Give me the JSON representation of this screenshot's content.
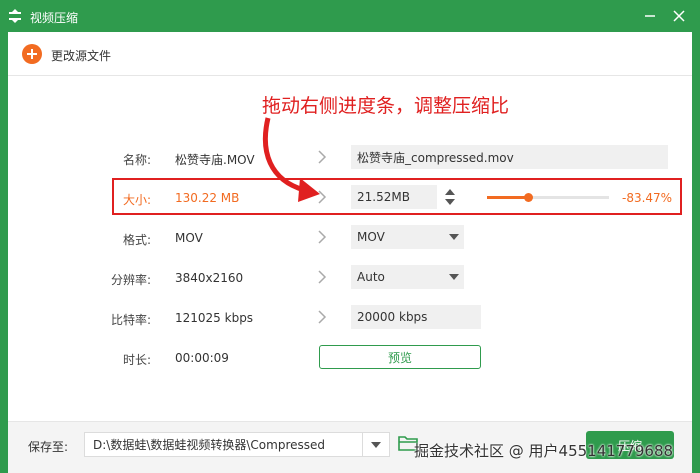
{
  "window": {
    "title": "视频压缩",
    "icon": "app-logo-icon",
    "minimize_icon": "minimize-icon",
    "close_icon": "close-icon",
    "accent_color": "#2f9b4d"
  },
  "toolbar": {
    "add_icon": "plus-icon",
    "add_label": "更改源文件"
  },
  "annotation": {
    "text": "拖动右侧进度条，调整压缩比",
    "color": "#e02020"
  },
  "rows": {
    "name": {
      "label": "名称:",
      "source": "松赞寺庙.MOV",
      "output": "松赞寺庙_compressed.mov"
    },
    "size": {
      "label": "大小:",
      "source": "130.22 MB",
      "output": "21.52MB",
      "percent": "-83.47%",
      "slider_fraction": 0.34,
      "highlight_color": "#f26b21"
    },
    "format": {
      "label": "格式:",
      "source": "MOV",
      "output": "MOV"
    },
    "resolution": {
      "label": "分辨率:",
      "source": "3840x2160",
      "output": "Auto"
    },
    "bitrate": {
      "label": "比特率:",
      "source": "121025 kbps",
      "output": "20000 kbps"
    },
    "duration": {
      "label": "时长:",
      "source": "00:00:09"
    }
  },
  "preview_button": "预览",
  "bottom": {
    "save_label": "保存至:",
    "path": "D:\\数据蛙\\数据蛙视频转换器\\Compressed",
    "folder_icon": "folder-icon",
    "compress_button": "压缩"
  },
  "watermark": "掘金技术社区 @ 用户455141779688"
}
